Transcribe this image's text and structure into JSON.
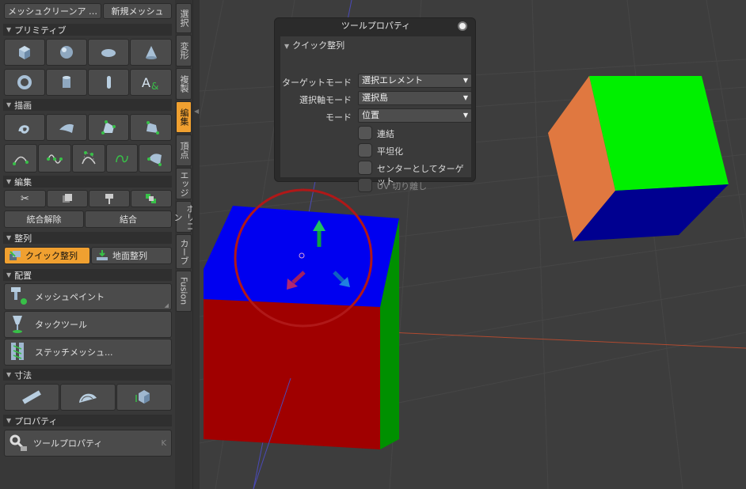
{
  "top_buttons": {
    "cleanup": "メッシュクリーンア …",
    "new_mesh": "新規メッシュ"
  },
  "sections": {
    "primitive": "プリミティブ",
    "draw": "描画",
    "edit": "編集",
    "align": "整列",
    "place": "配置",
    "dimension": "寸法",
    "property": "プロパティ"
  },
  "edit_buttons": {
    "unmerge": "統合解除",
    "merge": "結合"
  },
  "align_buttons": {
    "quick_align": "クイック整列",
    "ground_align": "地面整列"
  },
  "place_buttons": {
    "mesh_paint": "メッシュペイント",
    "tack_tool": "タックツール",
    "stitch_mesh": "ステッチメッシュ..."
  },
  "property_buttons": {
    "tool_props": "ツールプロパティ",
    "shortcut": "K"
  },
  "vertical_tabs": [
    "選択",
    "変形",
    "複製",
    "編集",
    "頂点",
    "エッジ",
    "ポリゴン",
    "カーブ",
    "Fusion"
  ],
  "tool_panel": {
    "title": "ツールプロパティ",
    "section": "クイック整列",
    "target_mode_label": "ターゲットモード",
    "target_mode_value": "選択エレメント",
    "axis_mode_label": "選択軸モード",
    "axis_mode_value": "選択島",
    "mode_label": "モード",
    "mode_value": "位置",
    "cb_connect": "連結",
    "cb_flatten": "平坦化",
    "cb_center": "センターとしてターゲット",
    "cb_uv": "UV 切り離し"
  },
  "colors": {
    "accent": "#f0a030",
    "cube_red": "#a00000",
    "cube_blue": "#0000f0",
    "cube_green": "#00a000"
  }
}
